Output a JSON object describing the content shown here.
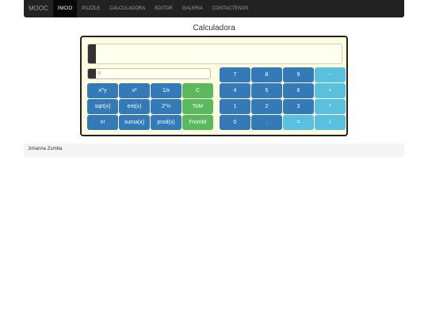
{
  "navbar": {
    "brand": "MOOC",
    "items": [
      "INICIO",
      "PUZZLE",
      "CALCULADORA",
      "EDITOR",
      "GALERIA",
      "CONTACTENOS"
    ]
  },
  "page": {
    "title": "Calculadora"
  },
  "calculator": {
    "display_value": "",
    "memory_placeholder": "0",
    "function_buttons": [
      [
        "x^y",
        "x²",
        "1/x",
        "C"
      ],
      [
        "sqrt(x)",
        "ent(x)",
        "2^n",
        "ToM"
      ],
      [
        "n!",
        "suma(x)",
        "prod(x)",
        "FromM"
      ]
    ],
    "keypad": [
      [
        "7",
        "8",
        "9",
        "-"
      ],
      [
        "4",
        "5",
        "6",
        "+"
      ],
      [
        "1",
        "2",
        "3",
        "*"
      ],
      [
        "0",
        ".",
        "=",
        "/"
      ]
    ]
  },
  "footer": {
    "author": "Johanna Zumba"
  },
  "colors": {
    "primary": "#337ab7",
    "success": "#5cb85c",
    "info": "#5bc0de",
    "calc_background": "#ffffe0",
    "navbar": "#222222"
  }
}
